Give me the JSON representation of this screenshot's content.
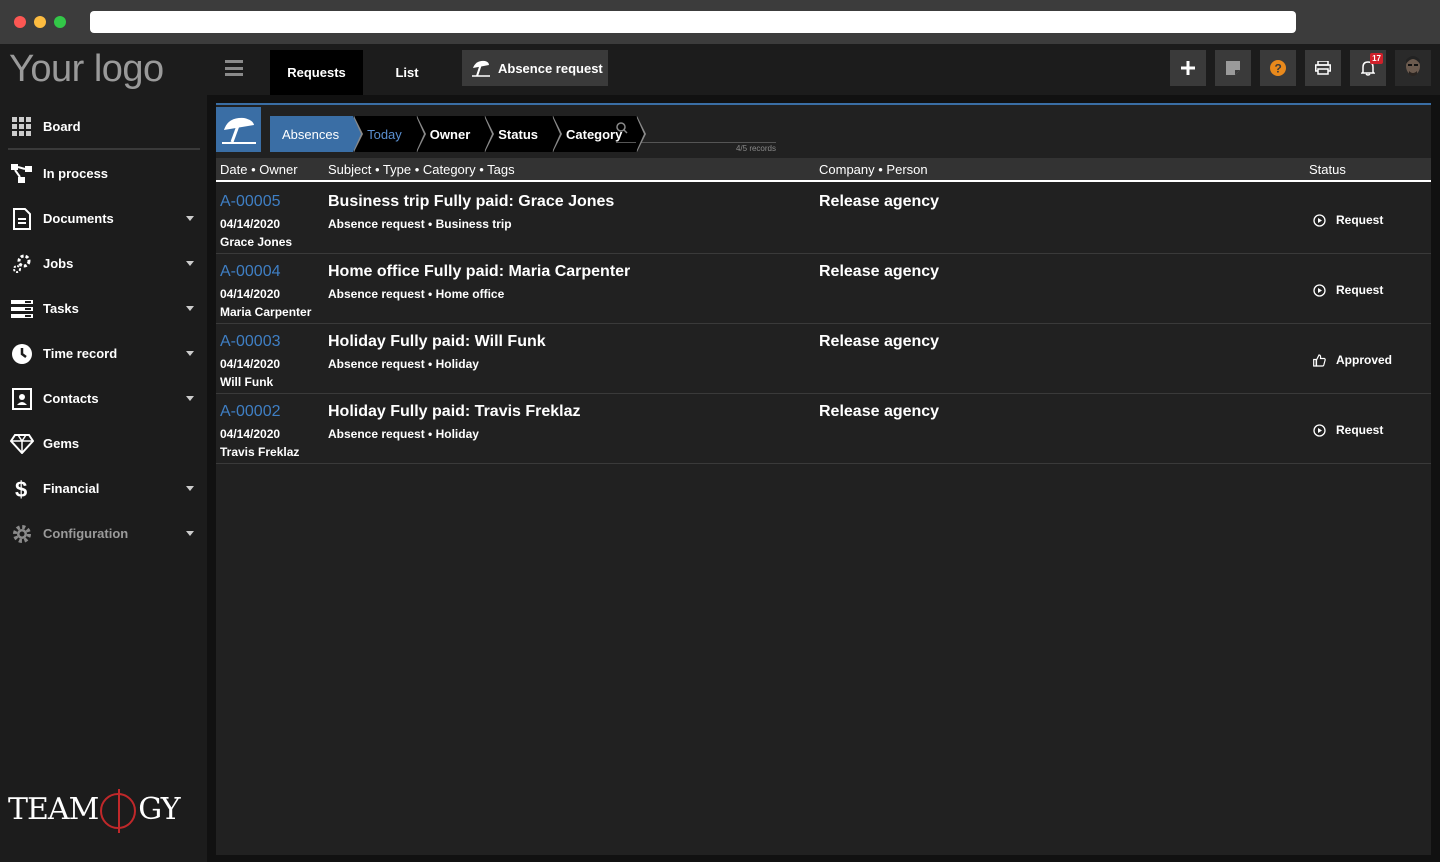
{
  "sidebar": {
    "logo_text": "Your logo",
    "items": [
      {
        "label": "Board",
        "icon": "grid-icon",
        "caret": false
      },
      {
        "label": "In process",
        "icon": "process-icon",
        "caret": false
      },
      {
        "label": "Documents",
        "icon": "document-icon",
        "caret": true
      },
      {
        "label": "Jobs",
        "icon": "gears-icon",
        "caret": true
      },
      {
        "label": "Tasks",
        "icon": "tasks-icon",
        "caret": true
      },
      {
        "label": "Time record",
        "icon": "clock-icon",
        "caret": true
      },
      {
        "label": "Contacts",
        "icon": "contact-card-icon",
        "caret": true
      },
      {
        "label": "Gems",
        "icon": "diamond-icon",
        "caret": false
      },
      {
        "label": "Financial",
        "icon": "dollar-icon",
        "caret": true
      },
      {
        "label": "Configuration",
        "icon": "gear-icon",
        "caret": true
      }
    ],
    "brand_text_left": "TEAM",
    "brand_text_right": "GY"
  },
  "topbar": {
    "tabs": [
      {
        "label": "Requests",
        "active": true
      },
      {
        "label": "List",
        "active": false
      }
    ],
    "absence_button": "Absence request",
    "notification_count": "17"
  },
  "filter": {
    "crumbs": [
      "Absences",
      "Today",
      "Owner",
      "Status",
      "Category"
    ],
    "records": "4/5 records"
  },
  "table": {
    "headers": [
      "Date • Owner",
      "Subject • Type • Category • Tags",
      "Company • Person",
      "Status"
    ],
    "rows": [
      {
        "id": "A-00005",
        "date": "04/14/2020",
        "owner": "Grace Jones",
        "subject": "Business trip Fully paid: Grace Jones",
        "meta": "Absence request • Business trip",
        "company": "Release agency",
        "status": "Request",
        "status_icon": "play-circle-icon"
      },
      {
        "id": "A-00004",
        "date": "04/14/2020",
        "owner": "Maria Carpenter",
        "subject": "Home office Fully paid: Maria Carpenter",
        "meta": "Absence request • Home office",
        "company": "Release agency",
        "status": "Request",
        "status_icon": "play-circle-icon"
      },
      {
        "id": "A-00003",
        "date": "04/14/2020",
        "owner": "Will Funk",
        "subject": "Holiday Fully paid: Will Funk",
        "meta": "Absence request • Holiday",
        "company": "Release agency",
        "status": "Approved",
        "status_icon": "thumbs-up-icon"
      },
      {
        "id": "A-00002",
        "date": "04/14/2020",
        "owner": "Travis Freklaz",
        "subject": "Holiday Fully paid: Travis Freklaz",
        "meta": "Absence request • Holiday",
        "company": "Release agency",
        "status": "Request",
        "status_icon": "play-circle-icon"
      }
    ]
  },
  "colors": {
    "accent": "#3a6ea5",
    "link": "#3f7fc4",
    "help": "#e8891c",
    "badge": "#d0202a"
  }
}
